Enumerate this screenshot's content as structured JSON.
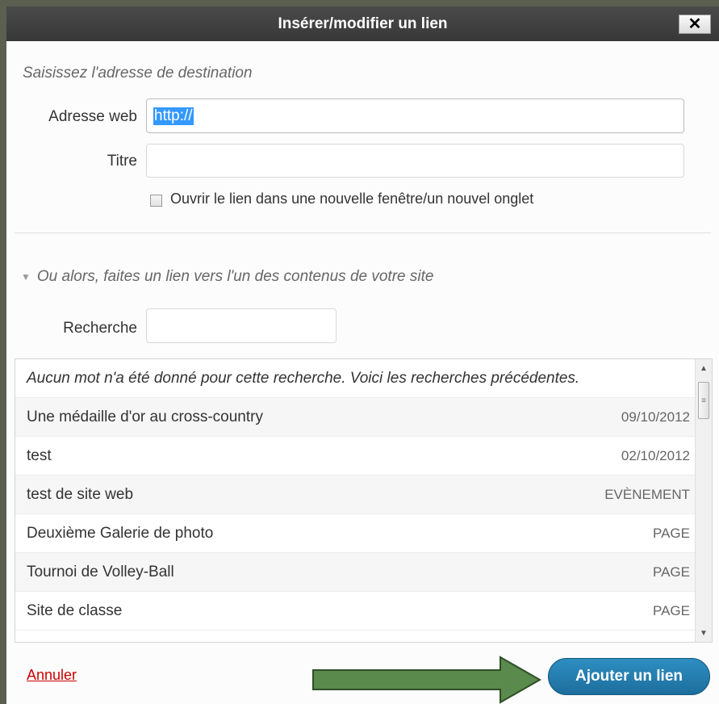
{
  "dialog": {
    "title": "Insérer/modifier un lien",
    "close_label": "✕"
  },
  "link_form": {
    "hint": "Saisissez l'adresse de destination",
    "url_label": "Adresse web",
    "url_value": "http://",
    "title_label": "Titre",
    "title_value": "",
    "new_tab_label": "Ouvrir le lien dans une nouvelle fenêtre/un nouvel onglet",
    "new_tab_checked": false
  },
  "internal_link": {
    "toggle_label": "Ou alors, faites un lien vers l'un des contenus de votre site",
    "search_label": "Recherche",
    "search_value": "",
    "results_notice": "Aucun mot n'a été donné pour cette recherche. Voici les recherches précédentes.",
    "results": [
      {
        "title": "Une médaille d'or au cross-country",
        "info": "09/10/2012"
      },
      {
        "title": "test",
        "info": "02/10/2012"
      },
      {
        "title": "test de site web",
        "info": "EVÈNEMENT"
      },
      {
        "title": "Deuxième Galerie de photo",
        "info": "PAGE"
      },
      {
        "title": "Tournoi de Volley-Ball",
        "info": "PAGE"
      },
      {
        "title": "Site de classe",
        "info": "PAGE"
      }
    ]
  },
  "footer": {
    "cancel_label": "Annuler",
    "submit_label": "Ajouter un lien"
  },
  "colors": {
    "arrow": "#5a8a4c",
    "submit": "#2381b3",
    "cancel": "#cc0000"
  }
}
